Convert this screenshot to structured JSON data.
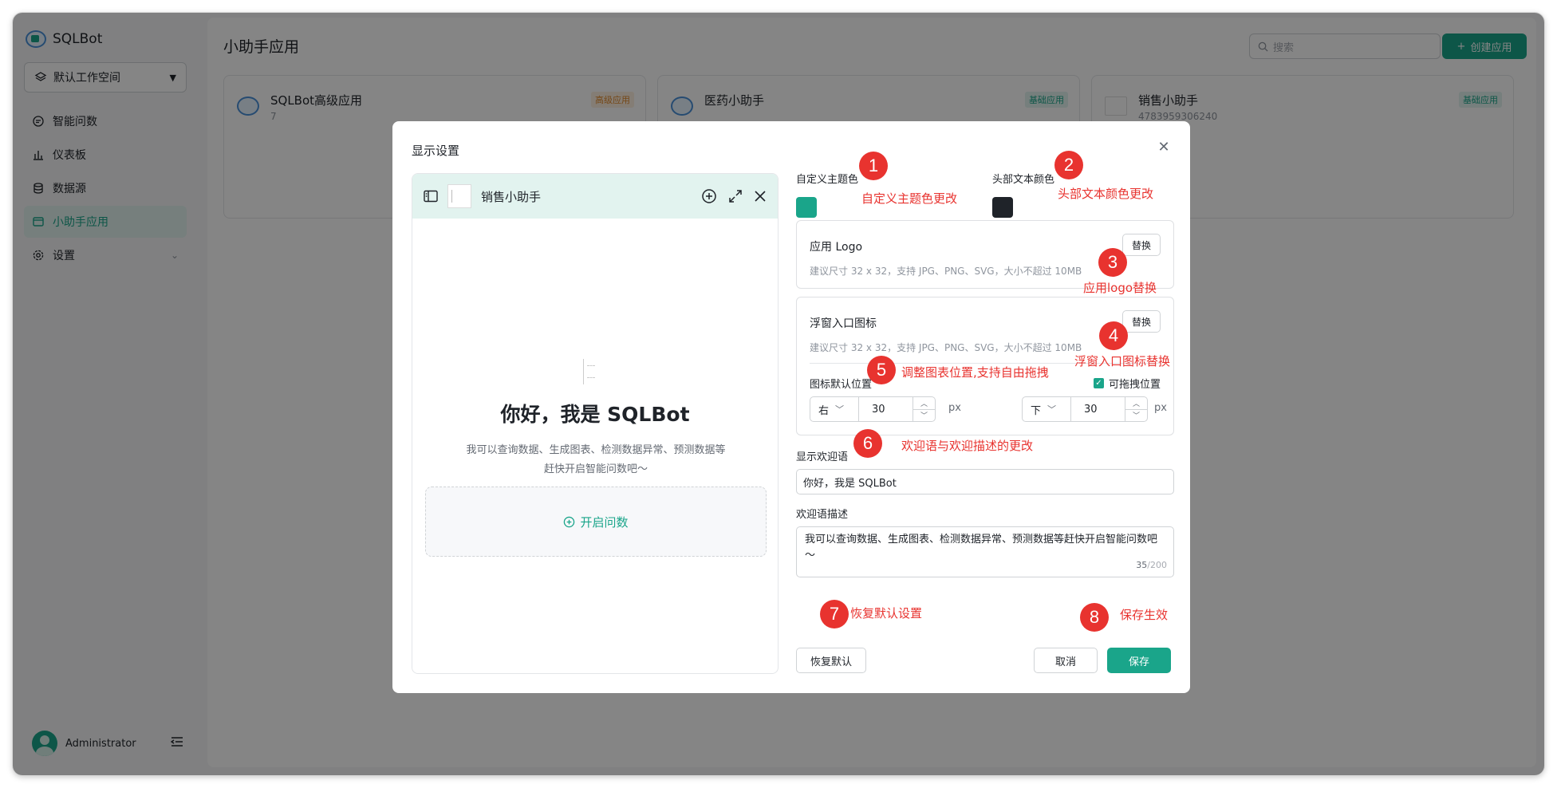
{
  "app": {
    "name": "SQLBot"
  },
  "sidebar": {
    "workspace": "默认工作空间",
    "items": [
      {
        "label": "智能问数",
        "icon": "chat-icon"
      },
      {
        "label": "仪表板",
        "icon": "bar-chart-icon"
      },
      {
        "label": "数据源",
        "icon": "database-icon"
      },
      {
        "label": "小助手应用",
        "icon": "app-icon",
        "active": true
      },
      {
        "label": "设置",
        "icon": "gear-icon"
      }
    ],
    "user": "Administrator"
  },
  "main": {
    "title": "小助手应用",
    "search_placeholder": "搜索",
    "create_label": "创建应用",
    "cards": [
      {
        "title": "SQLBot高级应用",
        "sub": "7",
        "tag": "高级应用"
      },
      {
        "title": "医药小助手",
        "sub": "",
        "tag": "基础应用"
      },
      {
        "title": "销售小助手",
        "sub": "4783959306240",
        "tag": "基础应用"
      }
    ]
  },
  "dialog": {
    "title": "显示设置",
    "preview": {
      "header_title": "销售小助手",
      "welcome": "你好，我是 SQLBot",
      "desc_line1": "我可以查询数据、生成图表、检测数据异常、预测数据等",
      "desc_line2": "赶快开启智能问数吧～",
      "start_label": "开启问数"
    },
    "theme_color_label": "自定义主题色",
    "theme_color": "#1aa58a",
    "header_text_color_label": "头部文本颜色",
    "header_text_color": "#1f2329",
    "logo": {
      "title": "应用 Logo",
      "hint": "建议尺寸 32 x 32，支持 JPG、PNG、SVG，大小不超过 10MB",
      "button": "替换"
    },
    "float_icon": {
      "title": "浮窗入口图标",
      "hint": "建议尺寸 32 x 32，支持 JPG、PNG、SVG，大小不超过 10MB",
      "button": "替换"
    },
    "position": {
      "label": "图标默认位置",
      "draggable_label": "可拖拽位置",
      "draggable": true,
      "x_side": "右",
      "x_value": "30",
      "y_side": "下",
      "y_value": "30",
      "unit": "px"
    },
    "welcome_label": "显示欢迎语",
    "welcome_value": "你好，我是 SQLBot",
    "desc_label": "欢迎语描述",
    "desc_value": "我可以查询数据、生成图表、检测数据异常、预测数据等赶快开启智能问数吧～",
    "desc_count": "35",
    "desc_max": "/200",
    "reset_label": "恢复默认",
    "cancel_label": "取消",
    "save_label": "保存"
  },
  "annotations": [
    {
      "num": "1",
      "text": "自定义主题色更改"
    },
    {
      "num": "2",
      "text": "头部文本颜色更改"
    },
    {
      "num": "3",
      "text": "应用logo替换"
    },
    {
      "num": "4",
      "text": "浮窗入口图标替换"
    },
    {
      "num": "5",
      "text": "调整图表位置,支持自由拖拽"
    },
    {
      "num": "6",
      "text": "欢迎语与欢迎描述的更改"
    },
    {
      "num": "7",
      "text": "恢复默认设置"
    },
    {
      "num": "8",
      "text": "保存生效"
    }
  ]
}
